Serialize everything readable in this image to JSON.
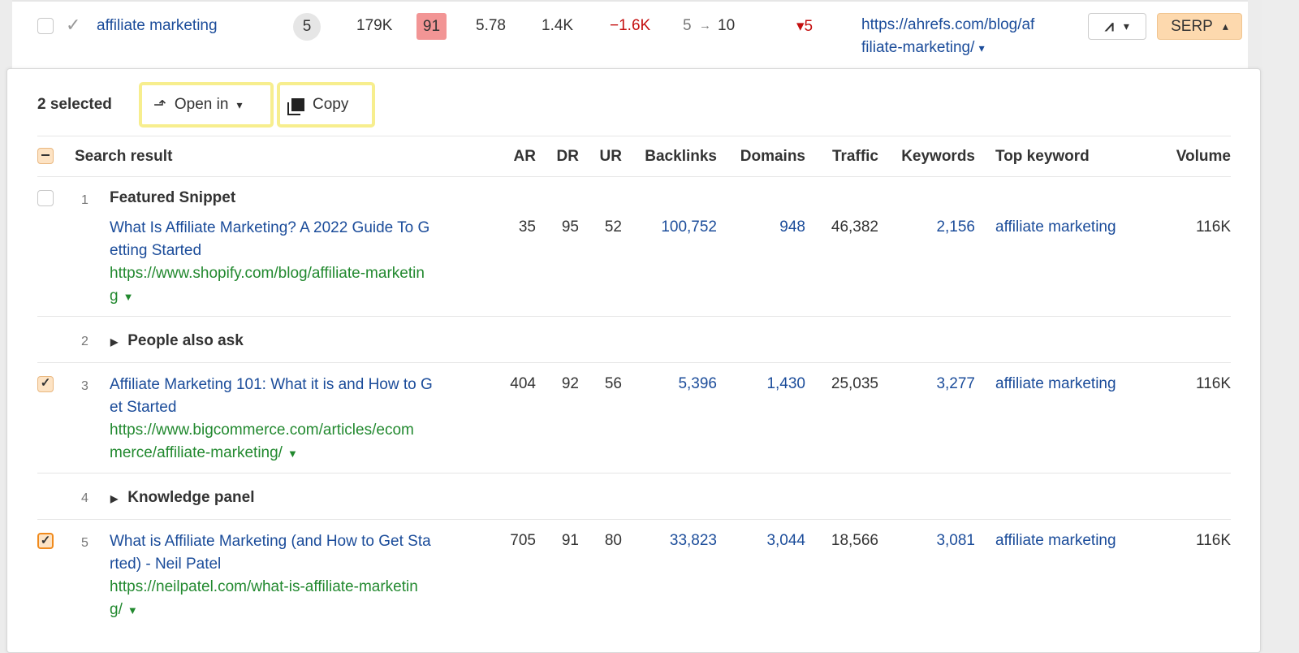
{
  "keyword_row": {
    "keyword": "affiliate marketing",
    "serp_features": "5",
    "volume": "179K",
    "kd": "91",
    "cpc": "5.78",
    "clicks": "1.4K",
    "change": "−1.6K",
    "position_from": "5",
    "position_arrow": "→",
    "position_to": "10",
    "position_change": "▾5",
    "url": "https://ahrefs.com/blog/affiliate-marketing/",
    "url_line1": "https://ahrefs.com/blog/af",
    "url_line2": "filiate-marketing/",
    "url_caret": "▾",
    "chart_button_caret": "▾",
    "serp_button": "SERP",
    "serp_caret": "▴",
    "kd_color": "#f29595"
  },
  "toolbar": {
    "selected_count": "2 selected",
    "open_in": "Open in",
    "open_in_caret": "▾",
    "copy": "Copy"
  },
  "columns": [
    "Search result",
    "AR",
    "DR",
    "UR",
    "Backlinks",
    "Domains",
    "Traffic",
    "Keywords",
    "Top keyword",
    "Volume"
  ],
  "rows": [
    {
      "rank": "1",
      "label": "Featured Snippet",
      "title1": "What Is Affiliate Marketing? A 2022 Guide To G",
      "title2": "etting Started",
      "url1": "https://www.shopify.com/blog/affiliate-marketin",
      "url2": "g",
      "ar": "35",
      "dr": "95",
      "ur": "52",
      "backlinks": "100,752",
      "domains": "948",
      "traffic": "46,382",
      "keywords": "2,156",
      "top_keyword": "affiliate marketing",
      "volume": "116K",
      "checked": false
    },
    {
      "rank": "2",
      "section": "People also ask"
    },
    {
      "rank": "3",
      "title1": "Affiliate Marketing 101: What it is and How to G",
      "title2": "et Started",
      "url1": "https://www.bigcommerce.com/articles/ecom",
      "url2": "merce/affiliate-marketing/",
      "ar": "404",
      "dr": "92",
      "ur": "56",
      "backlinks": "5,396",
      "domains": "1,430",
      "traffic": "25,035",
      "keywords": "3,277",
      "top_keyword": "affiliate marketing",
      "volume": "116K",
      "checked": true
    },
    {
      "rank": "4",
      "section": "Knowledge panel"
    },
    {
      "rank": "5",
      "title1": "What is Affiliate Marketing (and How to Get Sta",
      "title2": "rted) - Neil Patel",
      "url1": "https://neilpatel.com/what-is-affiliate-marketin",
      "url2": "g/",
      "ar": "705",
      "dr": "91",
      "ur": "80",
      "backlinks": "33,823",
      "domains": "3,044",
      "traffic": "18,566",
      "keywords": "3,081",
      "top_keyword": "affiliate marketing",
      "volume": "116K",
      "checked": true
    }
  ]
}
